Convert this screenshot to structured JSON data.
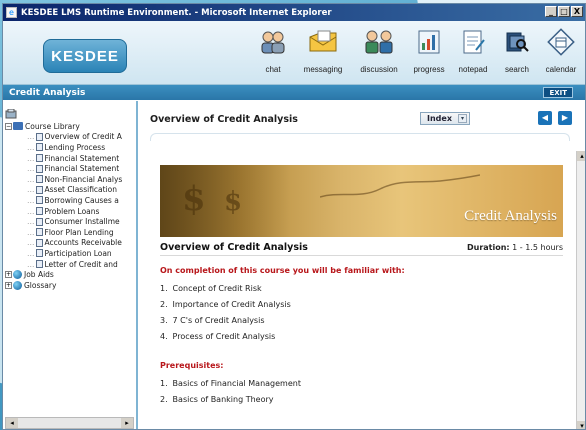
{
  "window": {
    "title": "KESDEE LMS Runtime Environment. - Microsoft Internet Explorer",
    "controls": [
      "_",
      "□",
      "X"
    ]
  },
  "header": {
    "logo_text": "KESDEE",
    "tools": [
      {
        "label": "chat",
        "icon": "chat-icon"
      },
      {
        "label": "messaging",
        "icon": "messaging-icon"
      },
      {
        "label": "discussion",
        "icon": "discussion-icon"
      },
      {
        "label": "progress",
        "icon": "progress-icon"
      },
      {
        "label": "notepad",
        "icon": "notepad-icon"
      },
      {
        "label": "search",
        "icon": "search-icon"
      },
      {
        "label": "calendar",
        "icon": "calendar-icon"
      }
    ]
  },
  "subbar": {
    "course_title": "Credit Analysis",
    "exit_label": "EXIT"
  },
  "sidebar": {
    "root": "Course Library",
    "items": [
      "Overview of Credit A",
      "Lending Process",
      "Financial Statement",
      "Financial Statement",
      "Non-Financial Analys",
      "Asset Classification",
      "Borrowing Causes a",
      "Problem Loans",
      "Consumer Installme",
      "Floor Plan Lending",
      "Accounts Receivable",
      "Participation Loan",
      "Letter of Credit and"
    ],
    "groups": [
      "Job Aids",
      "Glossary"
    ]
  },
  "main": {
    "title": "Overview of Credit Analysis",
    "index_label": "Index",
    "nav_prev": "◀",
    "nav_next": "▶",
    "banner_title": "Credit Analysis",
    "course_name": "Overview of Credit Analysis",
    "duration_label": "Duration:",
    "duration_value": "1 - 1.5 hours",
    "objectives_heading": "On completion of this course you will be familiar with:",
    "objectives": [
      "Concept of Credit Risk",
      "Importance of Credit Analysis",
      "7 C's of Credit Analysis",
      "Process of Credit Analysis"
    ],
    "prerequisites_heading": "Prerequisites:",
    "prerequisites": [
      "Basics of Financial Management",
      "Basics of Banking Theory"
    ]
  },
  "colors": {
    "accent": "#2a76a8",
    "heading_red": "#b8171b",
    "titlebar": "#0a246a"
  }
}
